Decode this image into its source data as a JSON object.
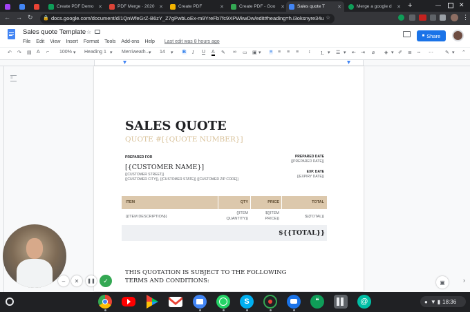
{
  "browser": {
    "tabs": [
      {
        "label": "",
        "color": "#a142f4"
      },
      {
        "label": "",
        "color": "#4285f4"
      },
      {
        "label": "",
        "color": "#ea4335"
      },
      {
        "label": "Create PDF Demo",
        "color": "#0f9d58"
      },
      {
        "label": "PDF Merge · 2020",
        "color": "#db4437"
      },
      {
        "label": "Create PDF",
        "color": "#f4b400"
      },
      {
        "label": "Create PDF - Goo",
        "color": "#34a853"
      },
      {
        "label": "Sales quote T",
        "color": "#4285f4"
      },
      {
        "label": "Merge a google d",
        "color": "#0f9d58"
      }
    ],
    "url": "docs.google.com/document/d/1QnWfeGrZ-B6zY_Z7gPwbLoEx-m9YreFb7fc9XPWkwDw/edit#heading=h.i3oksnyre34u"
  },
  "docs": {
    "title": "Sales quote Template",
    "menu": [
      "File",
      "Edit",
      "View",
      "Insert",
      "Format",
      "Tools",
      "Add-ons",
      "Help"
    ],
    "last_edit": "Last edit was 8 hours ago",
    "share_label": "Share"
  },
  "toolbar": {
    "zoom": "100%",
    "style": "Heading 1",
    "font": "Merriweath...",
    "size": "14"
  },
  "quote": {
    "title": "SALES QUOTE",
    "number": "QUOTE #[{QUOTE NUMBER}]",
    "prepared_for_label": "PREPARED FOR",
    "customer_name": "[{CUSTOMER NAME}]",
    "customer_street": "{{CUSTOMER STREET}}",
    "customer_address": "{{CUSTOMER CITY}}, {{CUSTOMER STATE}}  {{CUSTOMER ZIP CODE}}",
    "prepared_date_label": "PREPARED DATE",
    "prepared_date": "{{PREPARED DATE}}",
    "exp_date_label": "EXP. DATE",
    "expiry_date": "{{EXPIRY DATE}}",
    "table": {
      "headers": [
        "ITEM",
        "QTY",
        "PRICE",
        "TOTAL"
      ],
      "item": "{{ITEM DESCRIPTION}}",
      "qty_1": "{{ITEM",
      "qty_2": "QUANTITY}}",
      "price_1": "${{ITEM",
      "price_2": "PRICE}}",
      "total": "${{TOTAL}}",
      "grand_total": "${{TOTAL}}"
    },
    "terms_1": "THIS QUOTATION IS SUBJECT TO THE FOLLOWING",
    "terms_2": "TERMS AND CONDITIONS:"
  },
  "taskbar": {
    "time": "18:36",
    "apps": [
      "chrome-icon",
      "youtube-icon",
      "play-store-icon",
      "gmail-icon",
      "files-icon",
      "whatsapp-icon",
      "skype-icon",
      "screen-recorder-icon",
      "chat-icon",
      "hangouts-icon",
      "calculator-icon",
      "email-icon"
    ]
  },
  "colors": {
    "accent": "#1a73e8",
    "table_head": "#dcc8ac",
    "gold": "#d9c29a",
    "record": "#34a853"
  }
}
